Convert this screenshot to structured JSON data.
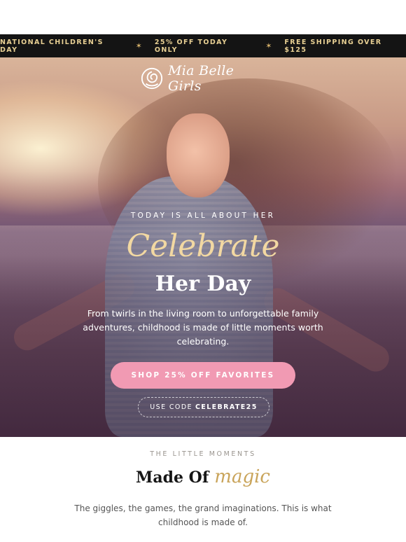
{
  "colors": {
    "topbar_bg": "#141414",
    "topbar_text": "#e7cf93",
    "accent_gold": "#c9a45a",
    "cta_pink": "#f19ab3"
  },
  "topbar": {
    "item1": "NATIONAL CHILDREN'S DAY",
    "sep1": "✶",
    "item2": "25% OFF TODAY ONLY",
    "sep2": "✶",
    "item3": "FREE SHIPPING OVER $125"
  },
  "brand": {
    "name": "Mia Belle Girls",
    "logo_icon": "rose-icon"
  },
  "hero": {
    "eyebrow": "TODAY IS ALL ABOUT HER",
    "title_script": "Celebrate",
    "title": "Her Day",
    "description": "From twirls in the living room to unforgettable family adventures, childhood is made of little moments worth celebrating.",
    "cta_label": "SHOP 25% OFF FAVORITES",
    "code_prefix": "USE CODE",
    "code_value": "CELEBRATE25"
  },
  "moments": {
    "eyebrow": "THE LITTLE MOMENTS",
    "title_plain": "Made Of",
    "title_script": "magic",
    "description": "The giggles, the games, the grand imaginations. This is what childhood is made of."
  }
}
